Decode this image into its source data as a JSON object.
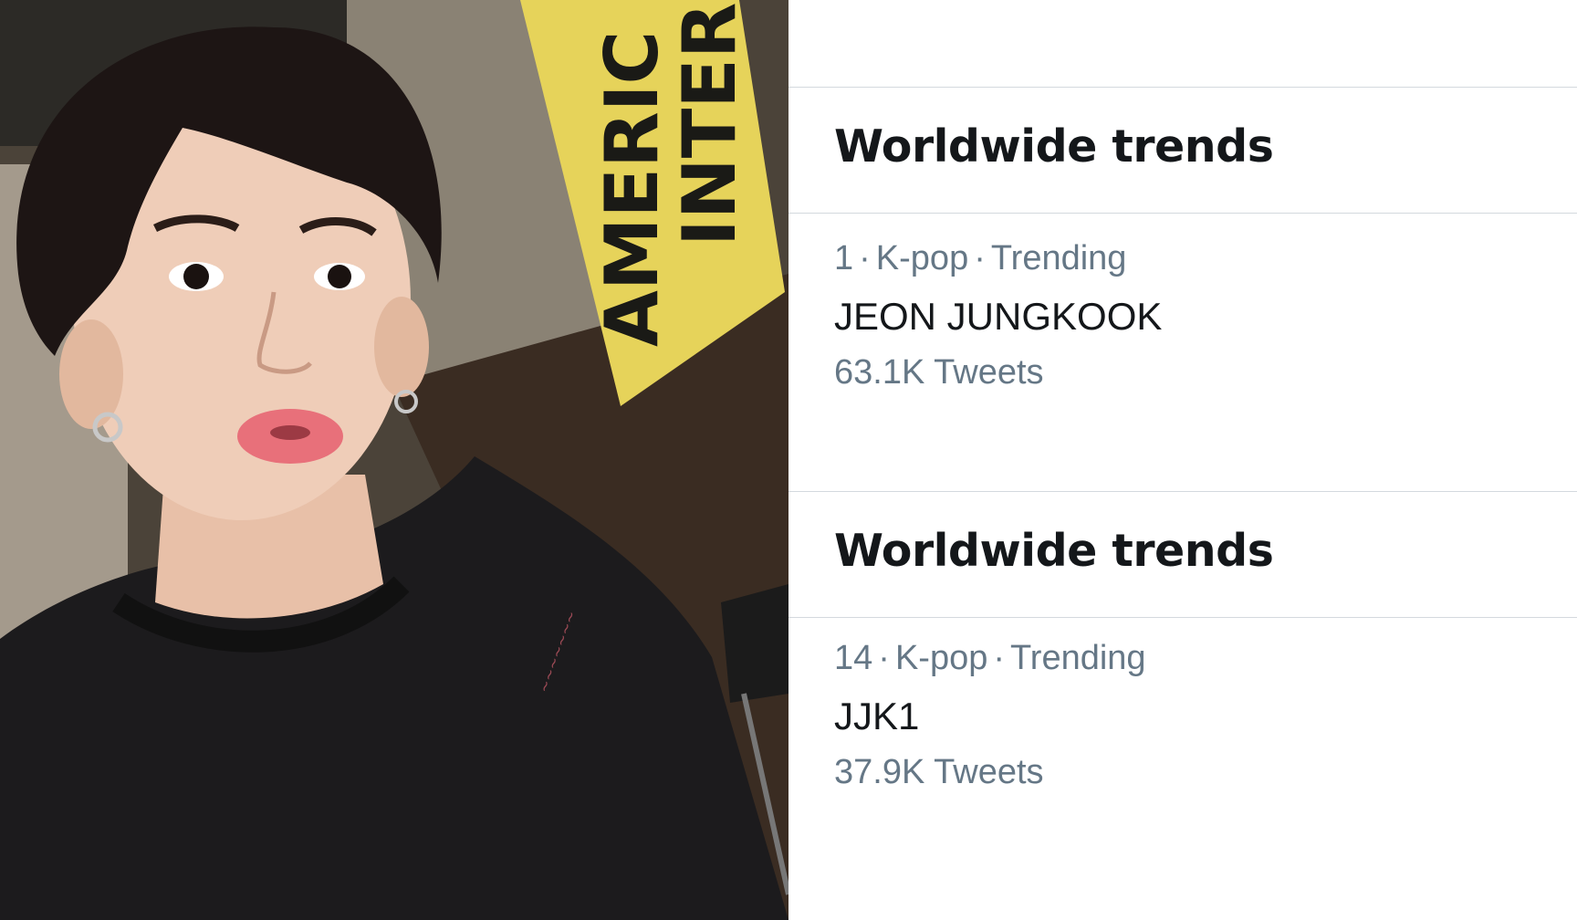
{
  "photo": {
    "sign_text": [
      "AMERIC",
      "INTER"
    ]
  },
  "sections": [
    {
      "title": "Worldwide trends",
      "trend": {
        "rank": "1",
        "category": "K-pop",
        "status": "Trending",
        "name": "JEON JUNGKOOK",
        "count": "63.1K Tweets"
      }
    },
    {
      "title": "Worldwide trends",
      "trend": {
        "rank": "14",
        "category": "K-pop",
        "status": "Trending",
        "name": "JJK1",
        "count": "37.9K Tweets"
      }
    }
  ],
  "separator": "·",
  "colors": {
    "text_primary": "#14171a",
    "text_secondary": "#657786",
    "divider": "#d4d9de"
  }
}
